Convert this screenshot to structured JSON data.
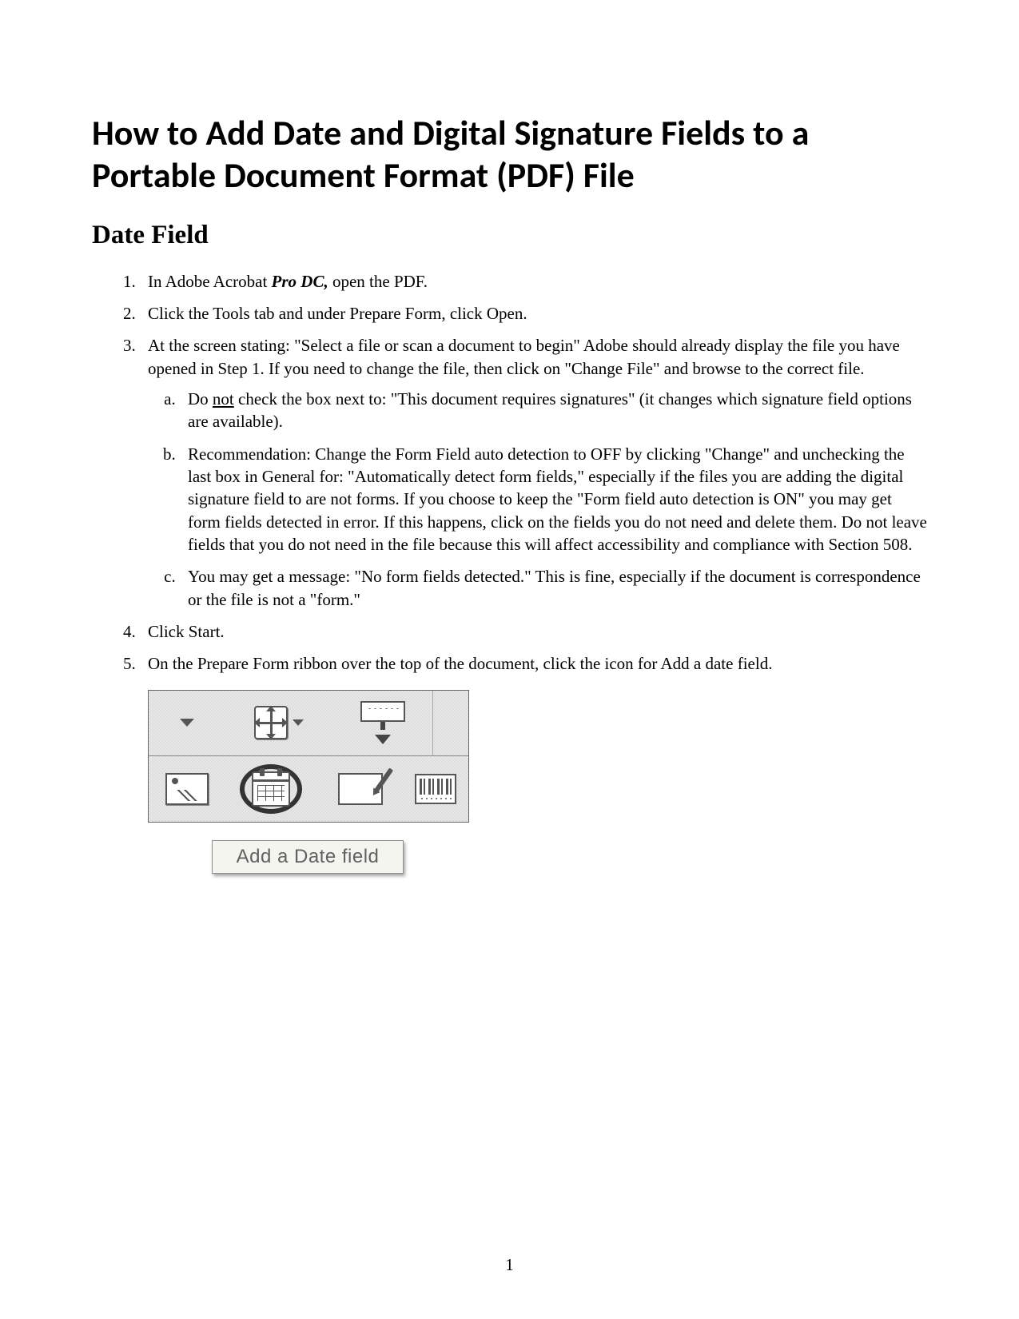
{
  "title": "How to Add Date and Digital Signature Fields to a Portable Document Format (PDF) File",
  "section_heading": "Date Field",
  "steps": {
    "s1_a": "In Adobe Acrobat ",
    "s1_b": "Pro DC,",
    "s1_c": " open the PDF.",
    "s2": "Click the Tools tab and under Prepare Form, click Open.",
    "s3": "At the screen stating: \"Select a file or scan a document to begin\" Adobe should already display the file you have opened in Step 1.  If you need to change the file, then click on \"Change File\" and browse to the correct file.",
    "s3a_a": "Do ",
    "s3a_b": "not",
    "s3a_c": " check the box next to: \"This document requires signatures\" (it changes which signature field options are available).",
    "s3b": "Recommendation:  Change the Form Field auto detection to OFF by clicking \"Change\" and unchecking the last box in General for: \"Automatically detect form fields,\" especially if the files you are adding the digital signature field to are not forms.  If you choose to keep the \"Form field auto detection is ON\" you may get form fields detected in error.  If this happens, click on the fields you do not need and delete them.  Do not leave fields that you do not need in the file because this will affect accessibility and compliance with Section 508.",
    "s3c": "You may get a message: \"No form fields detected.\"  This is fine, especially if the document is correspondence or the file is not a \"form.\"",
    "s4": "Click Start.",
    "s5": "On the Prepare Form ribbon over the top of the document, click the icon for Add a date field."
  },
  "ribbon": {
    "tooltip": "Add a Date field"
  },
  "page_number": "1"
}
